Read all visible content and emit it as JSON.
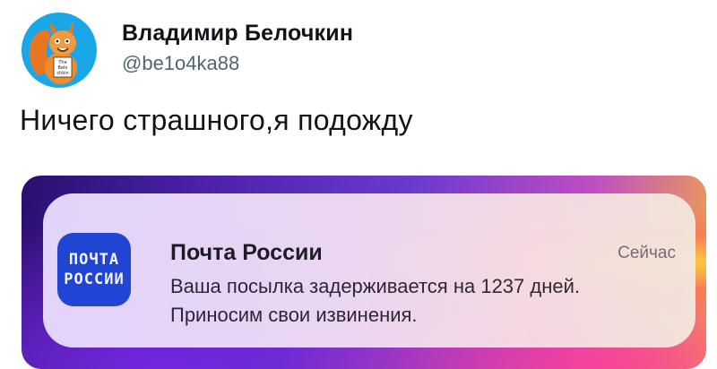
{
  "tweet": {
    "author_name": "Владимир Белочкин",
    "author_handle": "@be1o4ka88",
    "text": "Ничего страшного,я подожду",
    "avatar_lettering": [
      "The",
      "Belo",
      "chkin"
    ]
  },
  "notification": {
    "app_icon_lines": [
      "ПОЧТА",
      "РОССИИ"
    ],
    "app_name": "Почта России",
    "time": "Сейчас",
    "body_line1": "Ваша посылка задерживается на 1237 дней.",
    "body_line2": "Приносим свои извинения.",
    "icon_color": "#1f47d6"
  },
  "colors": {
    "avatar_bg": "#1aa7e8",
    "text_primary": "#0f1419",
    "text_secondary": "#536471"
  }
}
